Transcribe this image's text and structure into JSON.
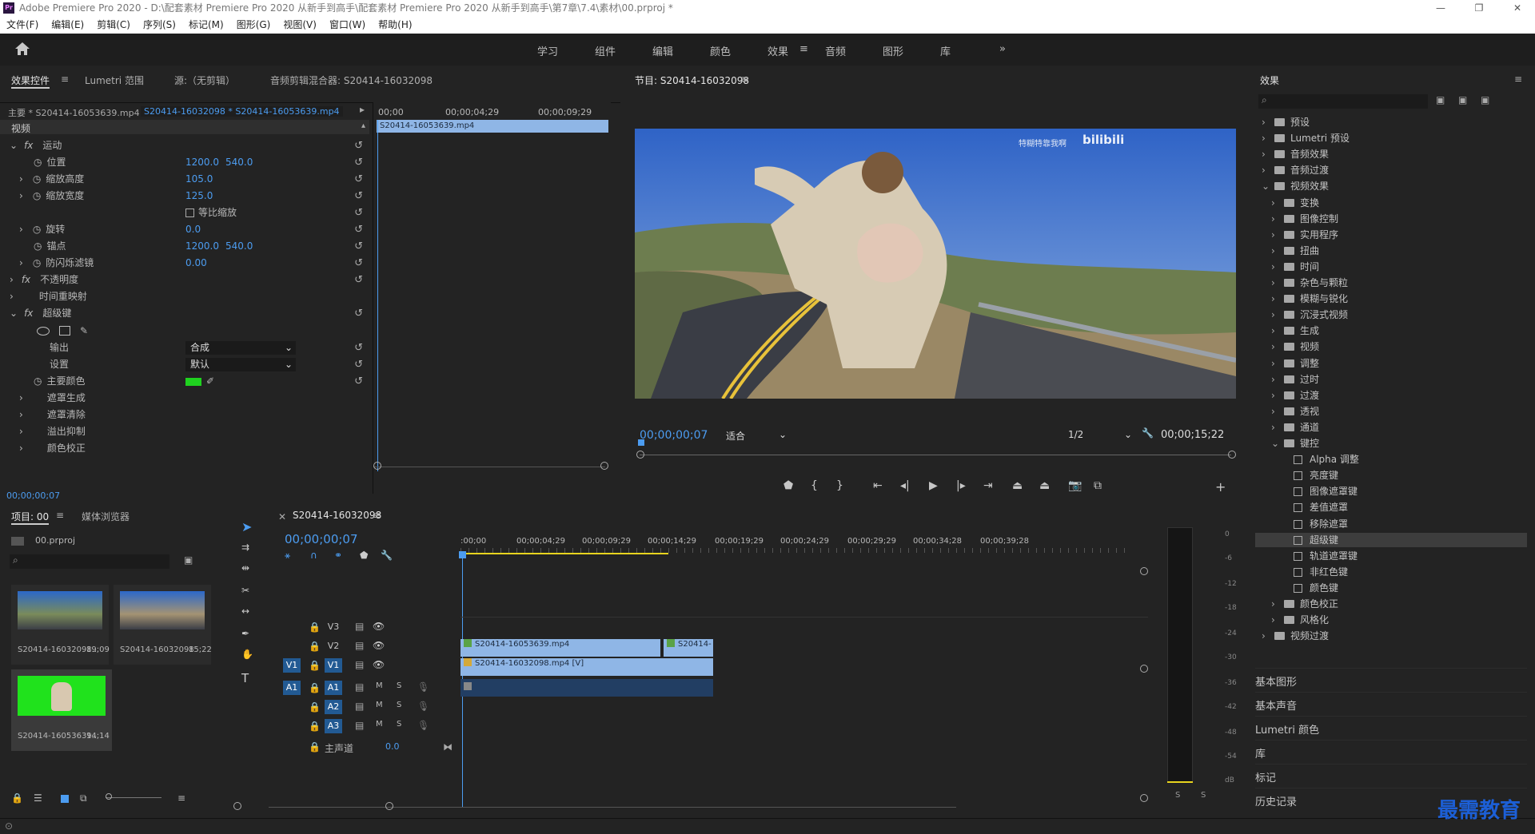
{
  "app": {
    "title": "Adobe Premiere Pro 2020 - D:\\配套素材 Premiere Pro 2020 从新手到高手\\配套素材 Premiere Pro 2020 从新手到高手\\第7章\\7.4\\素材\\00.prproj *"
  },
  "menu": [
    "文件(F)",
    "编辑(E)",
    "剪辑(C)",
    "序列(S)",
    "标记(M)",
    "图形(G)",
    "视图(V)",
    "窗口(W)",
    "帮助(H)"
  ],
  "workspaces": [
    "学习",
    "组件",
    "编辑",
    "颜色",
    "效果",
    "音频",
    "图形",
    "库"
  ],
  "active_workspace": "效果",
  "effect_controls": {
    "tabs": [
      "效果控件",
      "Lumetri 范围",
      "源:（无剪辑）",
      "音频剪辑混合器: S20414-16032098"
    ],
    "master": "主要 * S20414-16053639.mp4",
    "sequence": "S20414-16032098 * S20414-16053639.mp4",
    "ruler": [
      "00;00",
      "00;00;04;29",
      "00;00;09;29"
    ],
    "clip_label": "S20414-16053639.mp4",
    "section": "视频",
    "motion": "运动",
    "position": {
      "label": "位置",
      "x": "1200.0",
      "y": "540.0"
    },
    "scale_h": {
      "label": "缩放高度",
      "v": "105.0"
    },
    "scale_w": {
      "label": "缩放宽度",
      "v": "125.0"
    },
    "uniform": "等比缩放",
    "rotation": {
      "label": "旋转",
      "v": "0.0"
    },
    "anchor": {
      "label": "锚点",
      "x": "1200.0",
      "y": "540.0"
    },
    "flicker": {
      "label": "防闪烁滤镜",
      "v": "0.00"
    },
    "opacity": "不透明度",
    "time_remap": "时间重映射",
    "ultra": "超级键",
    "output": {
      "label": "输出",
      "v": "合成"
    },
    "setting": {
      "label": "设置",
      "v": "默认"
    },
    "key_color": {
      "label": "主要颜色",
      "color": "#1fd21f"
    },
    "matte_gen": "遮罩生成",
    "matte_clean": "遮罩清除",
    "spill": "溢出抑制",
    "color_corr": "颜色校正",
    "timecode": "00;00;00;07"
  },
  "program": {
    "title": "节目: S20414-16032098",
    "watermark": "特糊特靠我啊",
    "brand": "bilibili",
    "timecode": "00;00;00;07",
    "fit": "适合",
    "resolution": "1/2",
    "duration": "00;00;15;22"
  },
  "project": {
    "tabs": [
      "项目: 00",
      "媒体浏览器"
    ],
    "file": "00.prproj",
    "items": [
      {
        "name": "S20414-16032098...",
        "dur": "19;09"
      },
      {
        "name": "S20414-16032098",
        "dur": "15;22"
      },
      {
        "name": "S20414-16053639...",
        "dur": "14;14"
      }
    ]
  },
  "timeline": {
    "title": "S20414-16032098",
    "timecode": "00;00;00;07",
    "ruler": [
      ":00;00",
      "00;00;04;29",
      "00;00;09;29",
      "00;00;14;29",
      "00;00;19;29",
      "00;00;24;29",
      "00;00;29;29",
      "00;00;34;28",
      "00;00;39;28"
    ],
    "tracks": {
      "v3": "V3",
      "v2": "V2",
      "v1": "V1",
      "v1_src": "V1",
      "a1_src": "A1",
      "a1": "A1",
      "a2": "A2",
      "a3": "A3"
    },
    "master": "主声道",
    "master_val": "0.0",
    "m": "M",
    "s": "S",
    "clip_v2": "S20414-16053639.mp4",
    "clip_v2b": "S20414-",
    "clip_v1": "S20414-16032098.mp4 [V]"
  },
  "effects_panel": {
    "title": "效果",
    "items": [
      {
        "label": "预设",
        "level": 0,
        "open": false
      },
      {
        "label": "Lumetri 预设",
        "level": 0,
        "open": false
      },
      {
        "label": "音频效果",
        "level": 0,
        "open": false
      },
      {
        "label": "音频过渡",
        "level": 0,
        "open": false
      },
      {
        "label": "视频效果",
        "level": 0,
        "open": true
      },
      {
        "label": "变换",
        "level": 1,
        "open": false
      },
      {
        "label": "图像控制",
        "level": 1,
        "open": false
      },
      {
        "label": "实用程序",
        "level": 1,
        "open": false
      },
      {
        "label": "扭曲",
        "level": 1,
        "open": false
      },
      {
        "label": "时间",
        "level": 1,
        "open": false
      },
      {
        "label": "杂色与颗粒",
        "level": 1,
        "open": false
      },
      {
        "label": "模糊与锐化",
        "level": 1,
        "open": false
      },
      {
        "label": "沉浸式视频",
        "level": 1,
        "open": false
      },
      {
        "label": "生成",
        "level": 1,
        "open": false
      },
      {
        "label": "视频",
        "level": 1,
        "open": false
      },
      {
        "label": "调整",
        "level": 1,
        "open": false
      },
      {
        "label": "过时",
        "level": 1,
        "open": false
      },
      {
        "label": "过渡",
        "level": 1,
        "open": false
      },
      {
        "label": "透视",
        "level": 1,
        "open": false
      },
      {
        "label": "通道",
        "level": 1,
        "open": false
      },
      {
        "label": "键控",
        "level": 1,
        "open": true
      },
      {
        "label": "Alpha 调整",
        "level": 2,
        "open": false
      },
      {
        "label": "亮度键",
        "level": 2,
        "open": false
      },
      {
        "label": "图像遮罩键",
        "level": 2,
        "open": false
      },
      {
        "label": "差值遮罩",
        "level": 2,
        "open": false
      },
      {
        "label": "移除遮罩",
        "level": 2,
        "open": false
      },
      {
        "label": "超级键",
        "level": 2,
        "open": false
      },
      {
        "label": "轨道遮罩键",
        "level": 2,
        "open": false
      },
      {
        "label": "非红色键",
        "level": 2,
        "open": false
      },
      {
        "label": "颜色键",
        "level": 2,
        "open": false
      },
      {
        "label": "颜色校正",
        "level": 1,
        "open": false
      },
      {
        "label": "风格化",
        "level": 1,
        "open": false
      },
      {
        "label": "视频过渡",
        "level": 0,
        "open": false
      }
    ],
    "selected": "超级键"
  },
  "right_panels": [
    "基本图形",
    "基本声音",
    "Lumetri 颜色",
    "库",
    "标记",
    "历史记录"
  ],
  "meter": [
    "0",
    "-6",
    "-12",
    "-18",
    "-24",
    "-30",
    "-36",
    "-42",
    "-48",
    "-54",
    "dB"
  ],
  "meter_s": [
    "S",
    "S"
  ],
  "corner_logo": "最需教育",
  "colors": {
    "accent": "#4c9cf0",
    "clip": "#8fb6e6",
    "green": "#1fd21f"
  }
}
